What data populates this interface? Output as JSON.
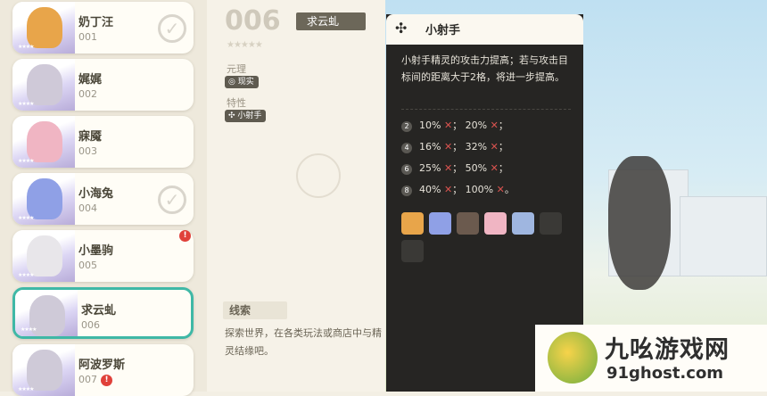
{
  "roster": [
    {
      "name": "奶丁汪",
      "number": "001",
      "collected": true,
      "alert": false,
      "color": "#e8a54a"
    },
    {
      "name": "娓娓",
      "number": "002",
      "collected": false,
      "alert": false,
      "color": "#cfc9d8"
    },
    {
      "name": "寐魇",
      "number": "003",
      "collected": false,
      "alert": false,
      "color": "#f0b5c3"
    },
    {
      "name": "小海兔",
      "number": "004",
      "collected": true,
      "alert": false,
      "color": "#8fa0e6"
    },
    {
      "name": "小墨驹",
      "number": "005",
      "collected": false,
      "alert": true,
      "color": "#e8e6ea"
    },
    {
      "name": "求云虬",
      "number": "006",
      "collected": false,
      "alert": false,
      "color": "#cfcad8",
      "selected": true
    },
    {
      "name": "阿波罗斯",
      "number": "007",
      "collected": false,
      "alert": true,
      "color": "#cfcad8"
    }
  ],
  "detail": {
    "number": "006",
    "name": "求云虬",
    "stars": "★★★★★",
    "element_label": "元理",
    "element": "现实",
    "trait_label": "特性",
    "trait": "小射手",
    "clue_label": "线索",
    "clue_text": "探索世界，在各类玩法或商店中与精灵结缘吧。"
  },
  "tooltip": {
    "icon": "trait-icon",
    "title": "小射手",
    "description": "小射手精灵的攻击力提高；若与攻击目标间的距离大于2格，将进一步提高。",
    "tiers": [
      {
        "level": "2",
        "a": "10%",
        "b": "20%"
      },
      {
        "level": "4",
        "a": "16%",
        "b": "32%"
      },
      {
        "level": "6",
        "a": "25%",
        "b": "50%"
      },
      {
        "level": "8",
        "a": "40%",
        "b": "100%"
      }
    ],
    "member_colors": [
      "#e8a54a",
      "#8fa0e6",
      "#6b5a4e",
      "#f0b5c3",
      "#9fb6e0",
      "#3a3936",
      "#3a3936"
    ]
  },
  "watermark": {
    "title": "九吆游戏网",
    "url": "91ghost.com"
  }
}
